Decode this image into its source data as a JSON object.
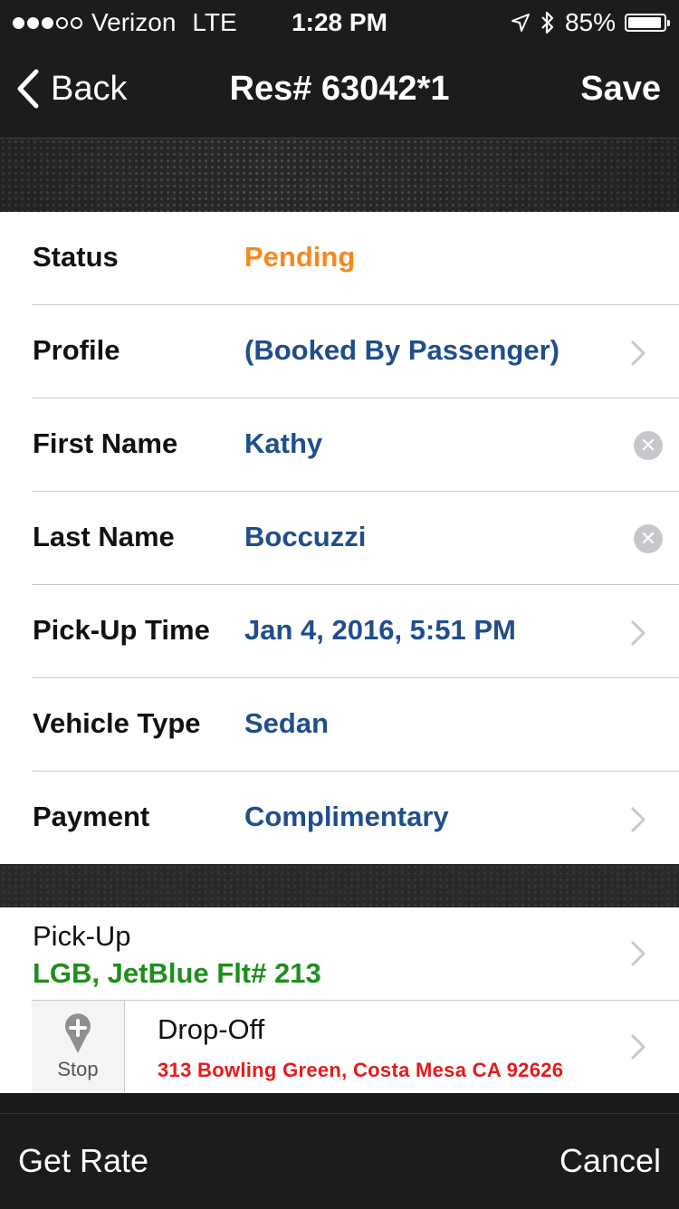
{
  "status_bar": {
    "carrier": "Verizon",
    "network": "LTE",
    "time": "1:28 PM",
    "battery": "85%",
    "battery_level": 0.85
  },
  "nav": {
    "back_label": "Back",
    "title": "Res# 63042*1",
    "save_label": "Save"
  },
  "form": {
    "rows": [
      {
        "label": "Status",
        "value": "Pending",
        "accessory": "none"
      },
      {
        "label": "Profile",
        "value": "(Booked By Passenger)",
        "accessory": "chevron"
      },
      {
        "label": "First Name",
        "value": "Kathy",
        "accessory": "clear"
      },
      {
        "label": "Last Name",
        "value": "Boccuzzi",
        "accessory": "clear"
      },
      {
        "label": "Pick-Up Time",
        "value": "Jan 4, 2016, 5:51 PM",
        "accessory": "chevron"
      },
      {
        "label": "Vehicle Type",
        "value": "Sedan",
        "accessory": "none"
      },
      {
        "label": "Payment",
        "value": "Complimentary",
        "accessory": "chevron"
      }
    ]
  },
  "pickup": {
    "label": "Pick-Up",
    "value": "LGB, JetBlue Flt# 213"
  },
  "dropoff": {
    "stop_label": "Stop",
    "label": "Drop-Off",
    "value": "313 Bowling Green, Costa Mesa CA 92626"
  },
  "toolbar": {
    "get_rate_label": "Get Rate",
    "cancel_label": "Cancel"
  },
  "colors": {
    "status_pending": "#f5891f",
    "value_blue": "#1f4e8c",
    "pickup_green": "#1e8e1e",
    "dropoff_red": "#e31b1b"
  }
}
